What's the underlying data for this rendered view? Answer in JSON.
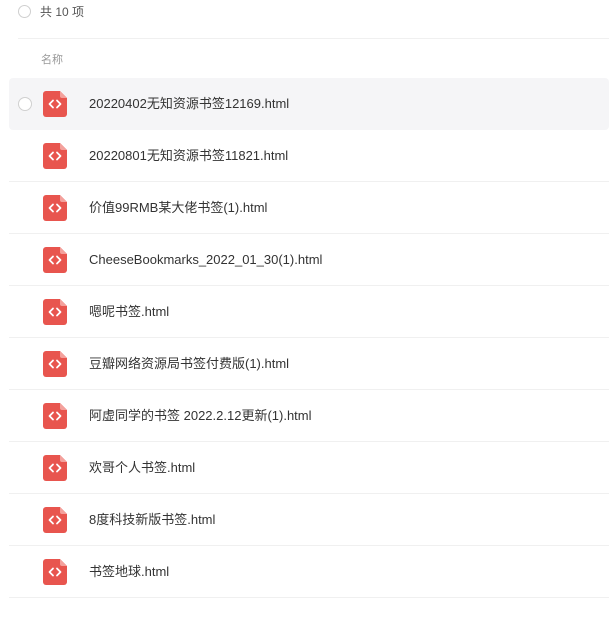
{
  "header": {
    "count_text": "共 10 项"
  },
  "columns": {
    "name_label": "名称"
  },
  "colors": {
    "icon_red": "#e8554e",
    "icon_fold": "#f4a19c"
  },
  "files": [
    {
      "name": "20220402无知资源书签12169.html",
      "icon": "html-file-icon"
    },
    {
      "name": "20220801无知资源书签11821.html",
      "icon": "html-file-icon"
    },
    {
      "name": "价值99RMB某大佬书签(1).html",
      "icon": "html-file-icon"
    },
    {
      "name": "CheeseBookmarks_2022_01_30(1).html",
      "icon": "html-file-icon"
    },
    {
      "name": "嗯呢书签.html",
      "icon": "html-file-icon"
    },
    {
      "name": "豆瓣网络资源局书签付费版(1).html",
      "icon": "html-file-icon"
    },
    {
      "name": "阿虚同学的书签 2022.2.12更新(1).html",
      "icon": "html-file-icon"
    },
    {
      "name": "欢哥个人书签.html",
      "icon": "html-file-icon"
    },
    {
      "name": "8度科技新版书签.html",
      "icon": "html-file-icon"
    },
    {
      "name": "书签地球.html",
      "icon": "html-file-icon"
    }
  ]
}
